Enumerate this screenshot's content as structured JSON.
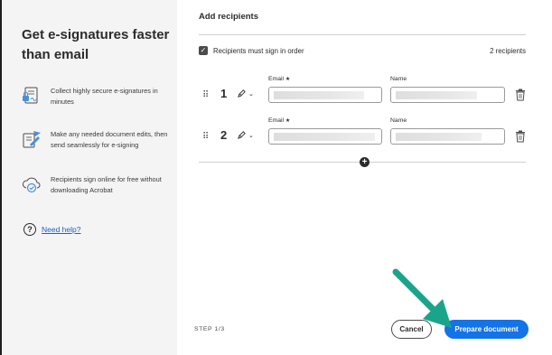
{
  "sidebar": {
    "title": "Get e-signatures faster than email",
    "features": [
      {
        "icon": "secure-document-icon",
        "text": "Collect highly secure e-signatures in minutes"
      },
      {
        "icon": "edit-send-icon",
        "text": "Make any needed document edits, then send seamlessly for e-signing"
      },
      {
        "icon": "cloud-check-icon",
        "text": "Recipients sign online for free without downloading Acrobat"
      }
    ],
    "help": {
      "icon": "help-icon",
      "glyph": "?",
      "label": "Need help?"
    }
  },
  "main": {
    "title": "Add recipients",
    "sign_in_order": {
      "checked": true,
      "glyph": "✓",
      "label": "Recipients must sign in order"
    },
    "recipient_count": "2 recipients",
    "email_label": "Email",
    "required_marker": "★",
    "name_label": "Name",
    "recipients": [
      {
        "number": "1",
        "role_icon": "pen-icon",
        "email": "",
        "name": ""
      },
      {
        "number": "2",
        "role_icon": "pen-icon",
        "email": "",
        "name": ""
      }
    ],
    "add_button": {
      "icon": "plus-circle-icon",
      "glyph": "+"
    }
  },
  "footer": {
    "step": "STEP 1/3",
    "cancel": "Cancel",
    "prepare": "Prepare document"
  },
  "colors": {
    "accent": "#1473e6",
    "arrow": "#1aa58b",
    "link": "#1a5fd0"
  }
}
